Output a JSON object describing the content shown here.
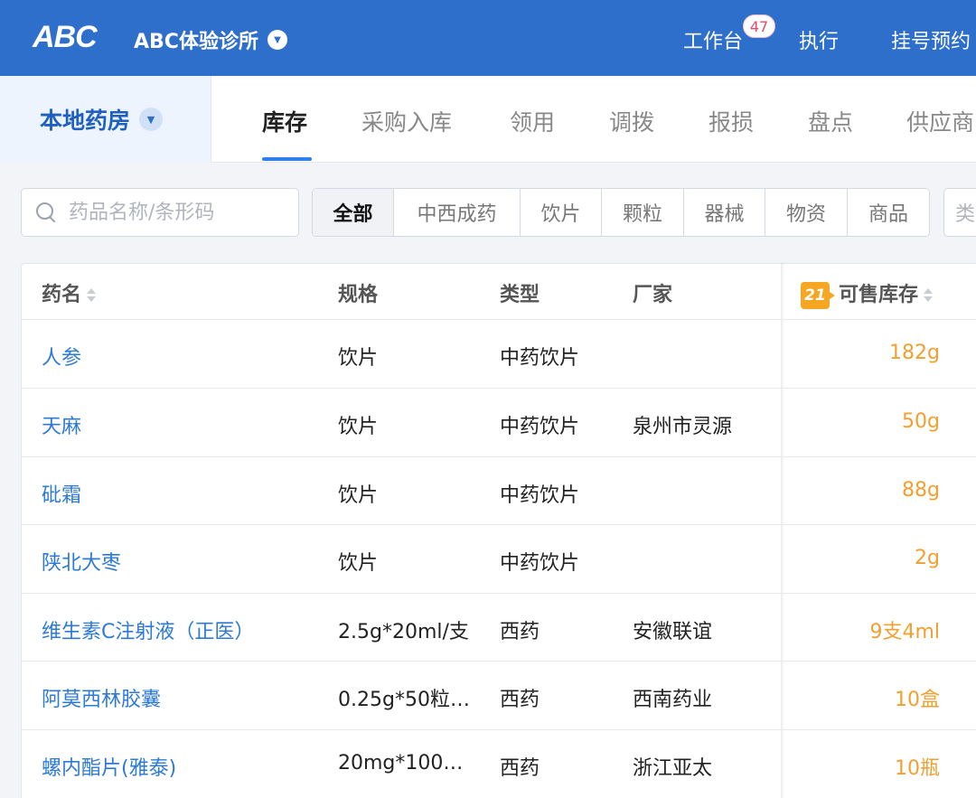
{
  "header": {
    "logo": "ABC",
    "clinic_name": "ABC体验诊所",
    "nav": [
      {
        "label": "工作台",
        "badge": "47"
      },
      {
        "label": "执行"
      },
      {
        "label": "挂号预约"
      }
    ]
  },
  "subheader": {
    "store": "本地药房",
    "tabs": [
      "库存",
      "采购入库",
      "领用",
      "调拨",
      "报损",
      "盘点",
      "供应商"
    ],
    "active_tab": "库存"
  },
  "filters": {
    "search_placeholder": "药品名称/条形码",
    "segments": [
      "全部",
      "中西成药",
      "饮片",
      "颗粒",
      "器械",
      "物资",
      "商品"
    ],
    "active_segment": "全部",
    "extra": "类"
  },
  "table": {
    "columns": [
      "药名",
      "规格",
      "类型",
      "厂家",
      "可售库存"
    ],
    "stock_alert_count": "21",
    "rows": [
      {
        "name": "人参",
        "spec": "饮片",
        "type": "中药饮片",
        "maker": "",
        "stock": "182g"
      },
      {
        "name": "天麻",
        "spec": "饮片",
        "type": "中药饮片",
        "maker": "泉州市灵源",
        "stock": "50g"
      },
      {
        "name": "砒霜",
        "spec": "饮片",
        "type": "中药饮片",
        "maker": "",
        "stock": "88g"
      },
      {
        "name": "陕北大枣",
        "spec": "饮片",
        "type": "中药饮片",
        "maker": "",
        "stock": "2g"
      },
      {
        "name": "维生素C注射液（正医）",
        "spec": "2.5g*20ml/支",
        "type": "西药",
        "maker": "安徽联谊",
        "stock": "9支4ml"
      },
      {
        "name": "阿莫西林胶囊",
        "spec": "0.25g*50粒…",
        "type": "西药",
        "maker": "西南药业",
        "stock": "10盒"
      },
      {
        "name": "螺内酯片(雅泰)",
        "spec": "20mg*100…",
        "type": "西药",
        "maker": "浙江亚太",
        "stock": "10瓶"
      }
    ]
  },
  "colors": {
    "topbar": "#2f6fcc",
    "link": "#2d7ad6",
    "stock": "#f0a030",
    "alert": "#f5a623"
  }
}
